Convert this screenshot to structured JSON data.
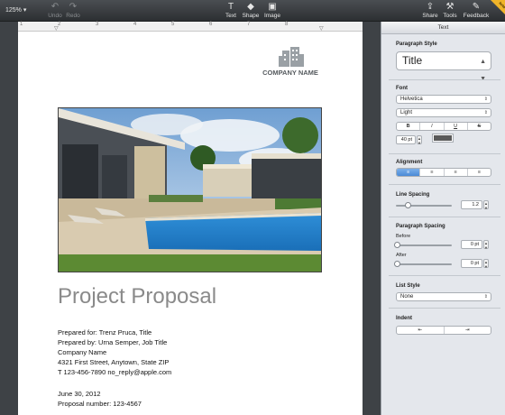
{
  "toolbar": {
    "zoom": "125% ▾",
    "undo": "Undo",
    "redo": "Redo",
    "text": "Text",
    "shape": "Shape",
    "image": "Image",
    "share": "Share",
    "tools": "Tools",
    "feedback": "Feedback",
    "beta": "beta"
  },
  "ruler": {
    "marks": [
      "1",
      "2",
      "3",
      "4",
      "5",
      "6",
      "7",
      "8"
    ]
  },
  "document": {
    "company_name": "COMPANY NAME",
    "title": "Project Proposal",
    "lines": [
      "Prepared for: Trenz Pruca, Title",
      "Prepared by: Urna Semper, Job Title",
      "Company Name",
      "4321 First Street, Anytown, State ZIP",
      "T 123-456-7890    no_reply@apple.com",
      "June 30, 2012",
      "Proposal number: 123-4567"
    ]
  },
  "inspector": {
    "tab": "Text",
    "paragraph_style_label": "Paragraph Style",
    "paragraph_style_value": "Title",
    "font_label": "Font",
    "font_family": "Helvetica",
    "font_weight": "Light",
    "style_buttons": [
      "B",
      "I",
      "U",
      "S"
    ],
    "font_size": "40 pt",
    "text_color": "#5a5a5a",
    "alignment_label": "Alignment",
    "alignment_options": [
      "left",
      "center",
      "right",
      "justify"
    ],
    "alignment_selected": "left",
    "line_spacing_label": "Line Spacing",
    "line_spacing_value": "1.2",
    "paragraph_spacing_label": "Paragraph Spacing",
    "before_label": "Before",
    "before_value": "0 pt",
    "after_label": "After",
    "after_value": "0 pt",
    "list_style_label": "List Style",
    "list_style_value": "None",
    "indent_label": "Indent"
  }
}
